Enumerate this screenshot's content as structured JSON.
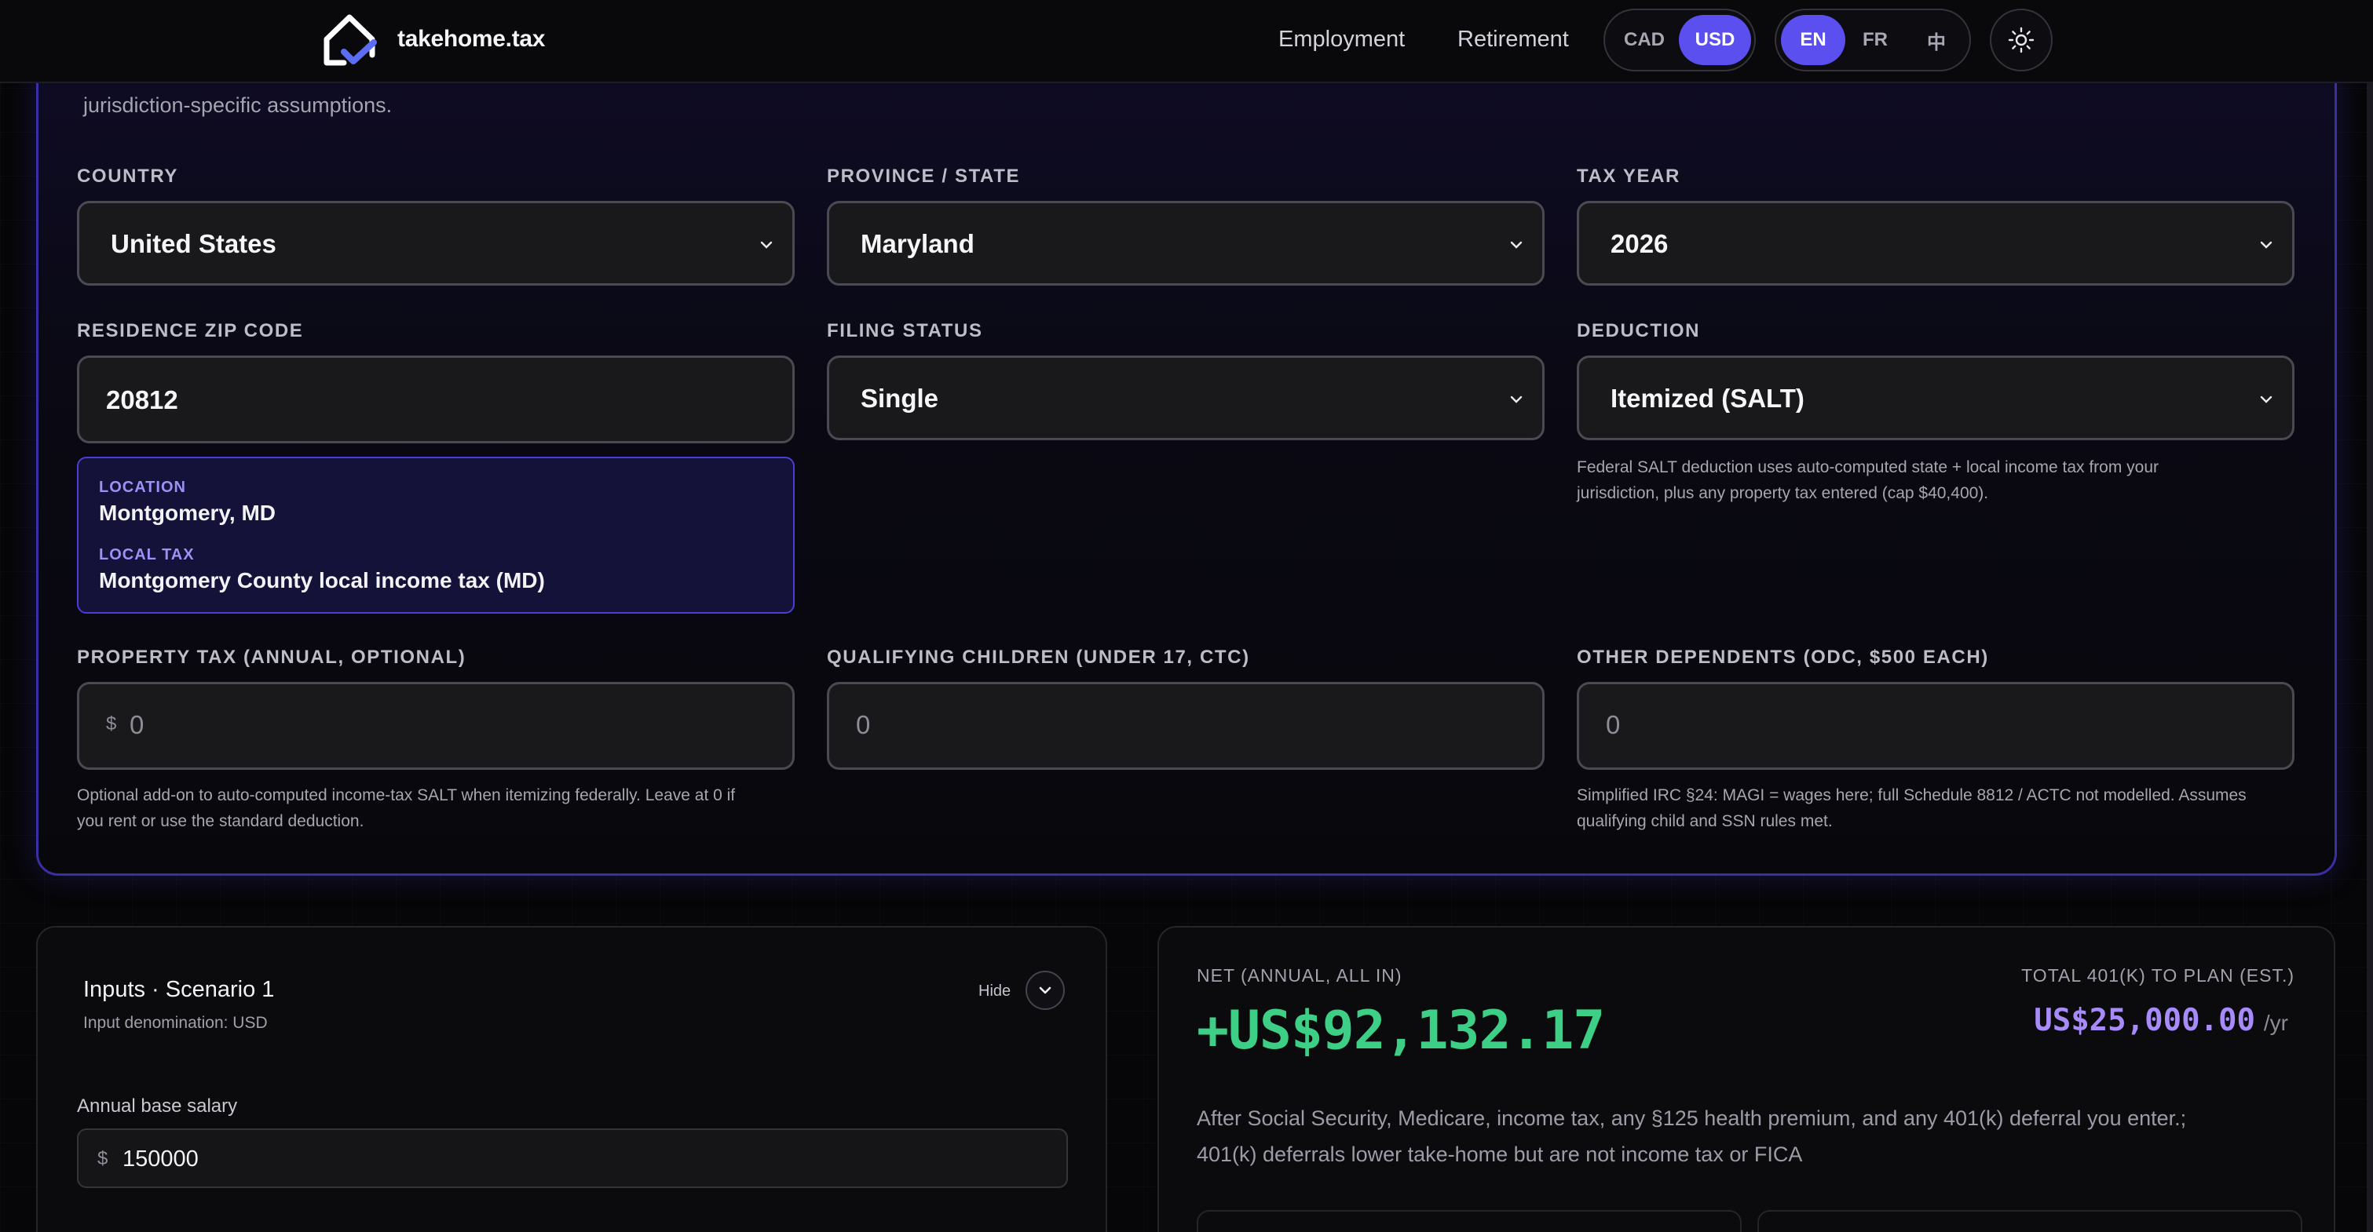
{
  "header": {
    "brand": "takehome.tax",
    "nav": {
      "employment": "Employment",
      "retirement": "Retirement"
    },
    "currency": {
      "options": [
        "CAD",
        "USD"
      ],
      "selected": "USD"
    },
    "language": {
      "options": [
        "EN",
        "FR",
        "中"
      ],
      "selected": "EN"
    },
    "theme_icon": "sun-icon"
  },
  "settings": {
    "intro": "jurisdiction-specific assumptions.",
    "country": {
      "label": "COUNTRY",
      "value": "United States"
    },
    "province": {
      "label": "PROVINCE / STATE",
      "value": "Maryland"
    },
    "tax_year": {
      "label": "TAX YEAR",
      "value": "2026"
    },
    "zip": {
      "label": "RESIDENCE ZIP CODE",
      "value": "20812"
    },
    "filing_status": {
      "label": "FILING STATUS",
      "value": "Single"
    },
    "deduction": {
      "label": "DEDUCTION",
      "value": "Itemized (SALT)",
      "help_line1": "Federal SALT deduction uses auto-computed state + local income tax from your",
      "help_line2": "jurisdiction, plus any property tax entered (cap $40,400)."
    },
    "location": {
      "location_label": "LOCATION",
      "location_value": "Montgomery, MD",
      "local_tax_label": "LOCAL TAX",
      "local_tax_value": "Montgomery County local income tax (MD)"
    },
    "property_tax": {
      "label": "PROPERTY TAX (ANNUAL, OPTIONAL)",
      "prefix": "$",
      "placeholder": "0",
      "help_line1": "Optional add-on to auto-computed income-tax SALT when itemizing federally. Leave at 0 if",
      "help_line2": "you rent or use the standard deduction."
    },
    "children": {
      "label": "QUALIFYING CHILDREN (UNDER 17, CTC)",
      "placeholder": "0"
    },
    "other_dependents": {
      "label": "OTHER DEPENDENTS (ODC, $500 EACH)",
      "placeholder": "0",
      "help_line1": "Simplified IRC §24: MAGI = wages here; full Schedule 8812 / ACTC not modelled. Assumes",
      "help_line2": "qualifying child and SSN rules met."
    }
  },
  "inputs_panel": {
    "title": "Inputs · Scenario 1",
    "subtitle": "Input denomination: USD",
    "hide_label": "Hide",
    "salary_label": "Annual base salary",
    "salary_prefix": "$",
    "salary_value": "150000"
  },
  "results_panel": {
    "net_label": "NET (ANNUAL, ALL IN)",
    "net_value": "+US$92,132.17",
    "plan_label": "TOTAL 401(K) TO PLAN (EST.)",
    "plan_value": "US$25,000.00",
    "plan_unit": "/yr",
    "desc_line1": "After Social Security, Medicare, income tax, any §125 health premium, and any 401(k) deferral you enter.;",
    "desc_line2": "401(k) deferrals lower take-home but are not income tax or FICA"
  },
  "colors": {
    "accent": "#5b4ff0",
    "net_green": "#3ecf86",
    "plan_purple": "#a78bfa",
    "card_border": "#3a2fa4"
  }
}
